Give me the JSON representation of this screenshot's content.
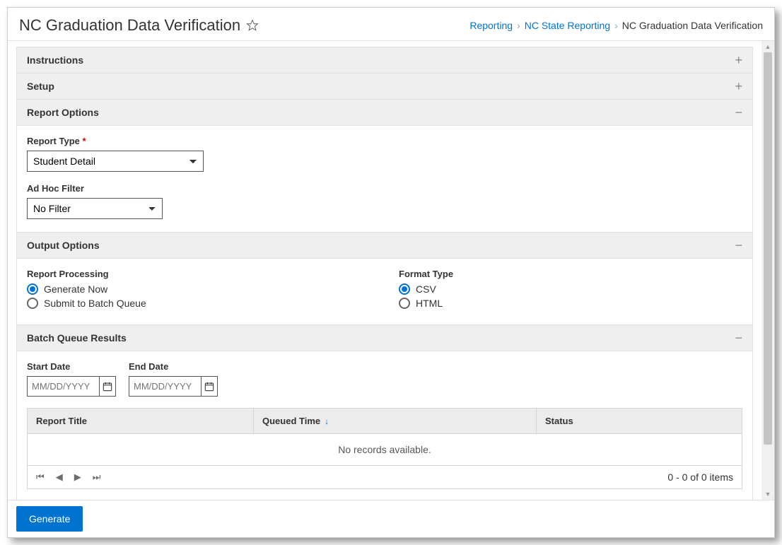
{
  "header": {
    "title": "NC Graduation Data Verification",
    "breadcrumb": [
      "Reporting",
      "NC State Reporting",
      "NC Graduation Data Verification"
    ]
  },
  "sections": {
    "instructions": {
      "title": "Instructions",
      "expanded": false
    },
    "setup": {
      "title": "Setup",
      "expanded": false
    },
    "report_options": {
      "title": "Report Options",
      "report_type_label": "Report Type",
      "report_type_value": "Student Detail",
      "adhoc_label": "Ad Hoc Filter",
      "adhoc_value": "No Filter"
    },
    "output_options": {
      "title": "Output Options",
      "processing_label": "Report Processing",
      "processing_opts": [
        "Generate Now",
        "Submit to Batch Queue"
      ],
      "processing_selected": 0,
      "format_label": "Format Type",
      "format_opts": [
        "CSV",
        "HTML"
      ],
      "format_selected": 0
    },
    "batch_queue": {
      "title": "Batch Queue Results",
      "start_label": "Start Date",
      "end_label": "End Date",
      "date_placeholder": "MM/DD/YYYY",
      "grid_cols": [
        "Report Title",
        "Queued Time",
        "Status"
      ],
      "empty_text": "No records available.",
      "pager_info": "0 - 0 of 0 items"
    }
  },
  "actions": {
    "generate": "Generate"
  }
}
